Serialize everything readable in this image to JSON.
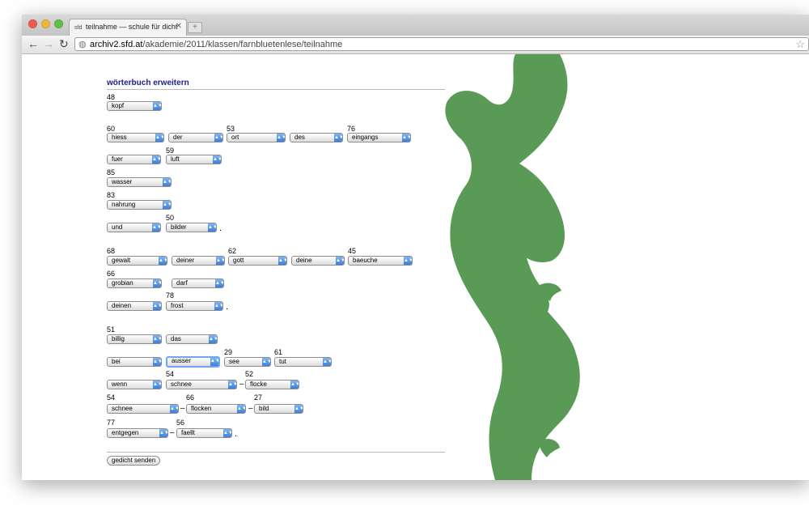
{
  "browser": {
    "tab_title": "teilnahme — schule für dicht",
    "tab_favicon": "sfd",
    "tab_close": "✕",
    "url_domain": "archiv2.sfd.at",
    "url_path": "/akademie/2011/klassen/farnbluetenlese/teilnahme",
    "back": "←",
    "forward": "→",
    "reload": "↻",
    "star": "☆",
    "new_tab": "+"
  },
  "page": {
    "section_title": "wörterbuch erweitern",
    "period": ".",
    "hyphen": "–",
    "numbers": [
      "48",
      "60",
      "53",
      "76",
      "59",
      "85",
      "83",
      "50",
      "68",
      "62",
      "45",
      "66",
      "78",
      "51",
      "29",
      "61",
      "54",
      "52",
      "54",
      "66",
      "27",
      "77",
      "56"
    ],
    "selects": [
      "kopf",
      "hiess",
      "der",
      "ort",
      "des",
      "eingangs",
      "fuer",
      "luft",
      "wasser",
      "nahrung",
      "und",
      "bilder",
      "gewalt",
      "deiner",
      "gott",
      "deine",
      "baeuche",
      "grobian",
      "darf",
      "deinen",
      "frost",
      "billig",
      "das",
      "bei",
      "ausser",
      "see",
      "tut",
      "wenn",
      "schnee",
      "flocke",
      "schnee",
      "flocken",
      "bild",
      "entgegen",
      "faellt"
    ],
    "send_button": "gedicht senden"
  },
  "colors": {
    "figure_green": "#5a9a57",
    "title_blue": "#1d1d8c",
    "select_arrow": "#3d7fd8"
  }
}
